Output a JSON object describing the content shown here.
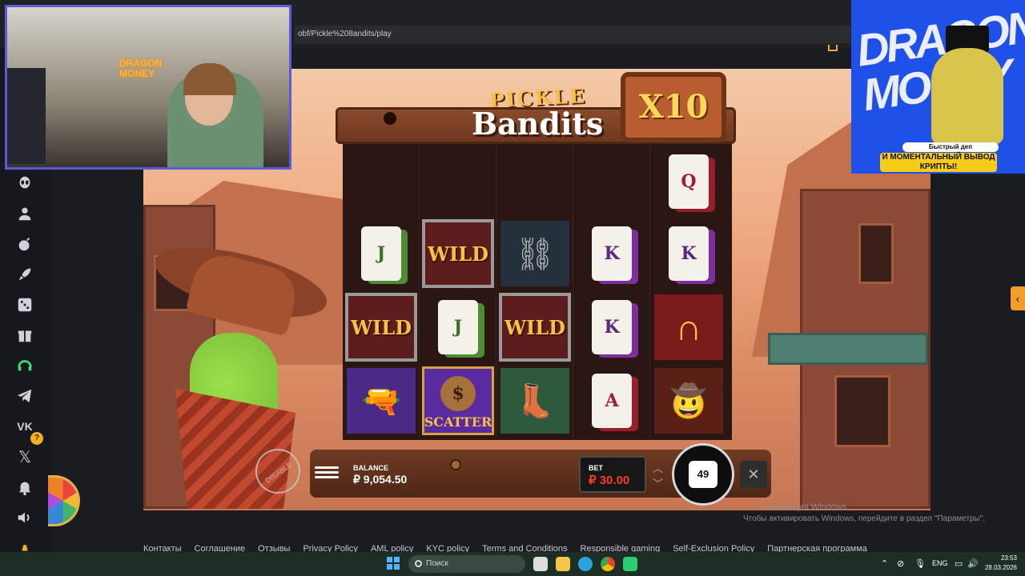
{
  "browser": {
    "url_fragment": "obf/Pickle%208andits/play"
  },
  "sidebar": {
    "items": [
      {
        "icon": "alien-icon"
      },
      {
        "icon": "user-icon"
      },
      {
        "icon": "bomb-icon"
      },
      {
        "icon": "rocket-icon"
      },
      {
        "icon": "dice-icon"
      },
      {
        "icon": "gift-icon"
      },
      {
        "icon": "headset-icon"
      },
      {
        "icon": "telegram-icon"
      },
      {
        "icon": "vk-icon"
      },
      {
        "icon": "x-icon"
      },
      {
        "icon": "bell-icon"
      },
      {
        "icon": "volume-icon"
      },
      {
        "icon": "lamp-icon"
      }
    ],
    "badge": "?"
  },
  "game": {
    "title_top": "PICKLE",
    "title_main": "Bandits",
    "multiplier": "X10",
    "disable_stamp": "DISABLE",
    "reels": [
      [
        "",
        "J",
        "WILD",
        ""
      ],
      [
        "",
        "WILD",
        "J",
        "SCATTER"
      ],
      [
        "",
        "handcuffs",
        "WILD",
        "boot"
      ],
      [
        "",
        "K",
        "K",
        "A"
      ],
      [
        "Q",
        "K",
        "horseshoe",
        "hat"
      ]
    ],
    "balance_label": "BALANCE",
    "balance_value": "₽ 9,054.50",
    "bet_label": "BET",
    "bet_value": "₽ 30.00",
    "autospin_count": "49",
    "accent": "#f6c04a"
  },
  "windows_watermark": {
    "line1": "Активация Windows",
    "line2": "Чтобы активировать Windows, перейдите в раздел \"Параметры\"."
  },
  "footer": {
    "links": [
      "Контакты",
      "Соглашение",
      "Отзывы",
      "Privacy Policy",
      "AML policy",
      "KYC policy",
      "Terms and Conditions",
      "Responsible gaming",
      "Self-Exclusion Policy",
      "Партнерская программа"
    ]
  },
  "stream_overlay": {
    "neon_sign": "DRAGON\nMONEY",
    "ad_graffiti": "DRAGON MONEY",
    "ad_line1": "Быстрый деп",
    "ad_line2": "И МОМЕНТАЛЬНЫЙ ВЫВОД КРИПТЫ!"
  },
  "taskbar": {
    "search_placeholder": "Поиск",
    "lang": "ENG",
    "time": "23:53",
    "date": "28.03.2026"
  }
}
